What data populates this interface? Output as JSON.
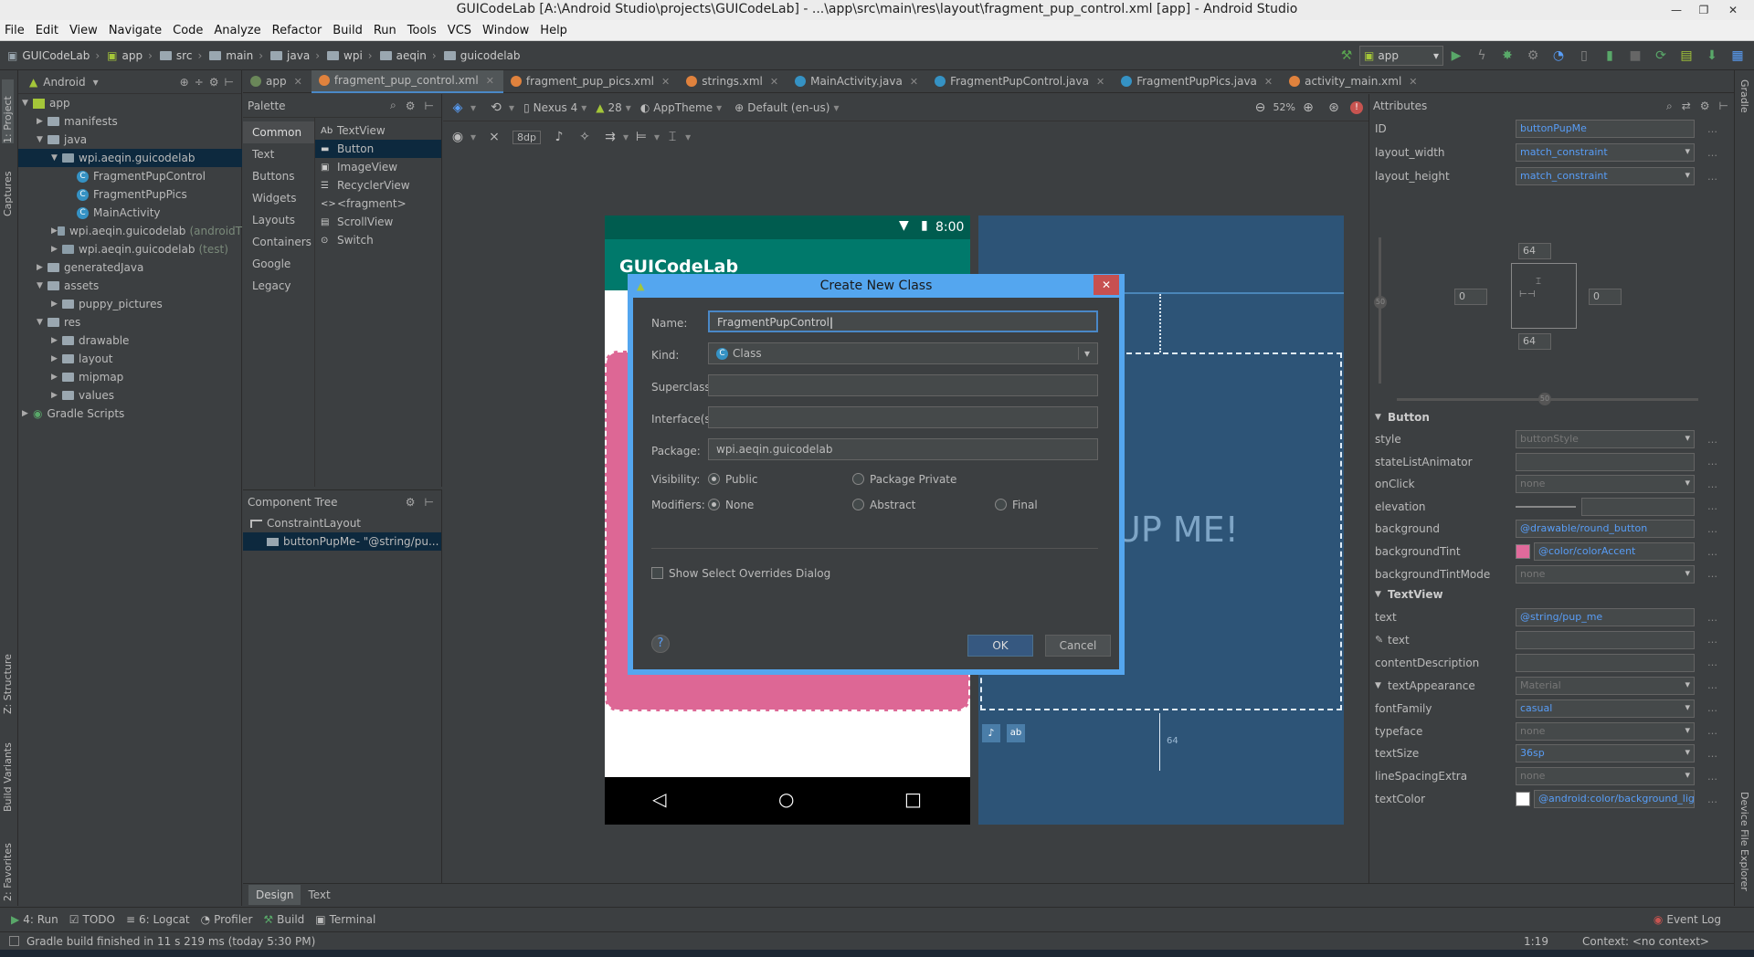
{
  "window": {
    "title": "GUICodeLab [A:\\Android Studio\\projects\\GUICodeLab] - ...\\app\\src\\main\\res\\layout\\fragment_pup_control.xml [app] - Android Studio"
  },
  "menu": [
    "File",
    "Edit",
    "View",
    "Navigate",
    "Code",
    "Analyze",
    "Refactor",
    "Build",
    "Run",
    "Tools",
    "VCS",
    "Window",
    "Help"
  ],
  "breadcrumbs": [
    "GUICodeLab",
    "app",
    "src",
    "main",
    "java",
    "wpi",
    "aeqin",
    "guicodelab"
  ],
  "run_config": "app",
  "left_stripe": [
    "1: Project",
    "Captures",
    "Z: Structure",
    "Build Variants",
    "2: Favorites"
  ],
  "right_stripe": [
    "Gradle",
    "Device File Explorer"
  ],
  "project": {
    "view": "Android",
    "tree": [
      {
        "label": "app",
        "level": 0,
        "arrow": "down",
        "icon": "module"
      },
      {
        "label": "manifests",
        "level": 1,
        "arrow": "right",
        "icon": "folder"
      },
      {
        "label": "java",
        "level": 1,
        "arrow": "down",
        "icon": "folder"
      },
      {
        "label": "wpi.aeqin.guicodelab",
        "level": 2,
        "arrow": "down",
        "icon": "package",
        "selected": true
      },
      {
        "label": "FragmentPupControl",
        "level": 3,
        "icon": "class"
      },
      {
        "label": "FragmentPupPics",
        "level": 3,
        "icon": "class"
      },
      {
        "label": "MainActivity",
        "level": 3,
        "icon": "class"
      },
      {
        "label": "wpi.aeqin.guicodelab",
        "suffix": "(androidT",
        "level": 2,
        "arrow": "right",
        "icon": "package"
      },
      {
        "label": "wpi.aeqin.guicodelab",
        "suffix": "(test)",
        "level": 2,
        "arrow": "right",
        "icon": "package"
      },
      {
        "label": "generatedJava",
        "level": 1,
        "arrow": "right",
        "icon": "folder"
      },
      {
        "label": "assets",
        "level": 1,
        "arrow": "down",
        "icon": "folder"
      },
      {
        "label": "puppy_pictures",
        "level": 2,
        "arrow": "right",
        "icon": "folder"
      },
      {
        "label": "res",
        "level": 1,
        "arrow": "down",
        "icon": "folder"
      },
      {
        "label": "drawable",
        "level": 2,
        "arrow": "right",
        "icon": "folder"
      },
      {
        "label": "layout",
        "level": 2,
        "arrow": "right",
        "icon": "folder"
      },
      {
        "label": "mipmap",
        "level": 2,
        "arrow": "right",
        "icon": "folder"
      },
      {
        "label": "values",
        "level": 2,
        "arrow": "right",
        "icon": "folder"
      },
      {
        "label": "Gradle Scripts",
        "level": 0,
        "arrow": "right",
        "icon": "gradle"
      }
    ]
  },
  "tabs": [
    {
      "label": "app",
      "color": "#6a8759"
    },
    {
      "label": "fragment_pup_control.xml",
      "color": "#e0823d",
      "active": true
    },
    {
      "label": "fragment_pup_pics.xml",
      "color": "#e0823d"
    },
    {
      "label": "strings.xml",
      "color": "#e0823d"
    },
    {
      "label": "MainActivity.java",
      "color": "#3592c4"
    },
    {
      "label": "FragmentPupControl.java",
      "color": "#3592c4"
    },
    {
      "label": "FragmentPupPics.java",
      "color": "#3592c4"
    },
    {
      "label": "activity_main.xml",
      "color": "#e0823d"
    }
  ],
  "palette": {
    "title": "Palette",
    "categories": [
      "Common",
      "Text",
      "Buttons",
      "Widgets",
      "Layouts",
      "Containers",
      "Google",
      "Legacy"
    ],
    "active_category": "Common",
    "items": [
      {
        "icon": "Ab",
        "label": "TextView"
      },
      {
        "icon": "▬",
        "label": "Button",
        "selected": true
      },
      {
        "icon": "▣",
        "label": "ImageView"
      },
      {
        "icon": "☰",
        "label": "RecyclerView"
      },
      {
        "icon": "<>",
        "label": "<fragment>"
      },
      {
        "icon": "▤",
        "label": "ScrollView"
      },
      {
        "icon": "⊙",
        "label": "Switch"
      }
    ]
  },
  "component_tree": {
    "title": "Component Tree",
    "items": [
      {
        "label": "ConstraintLayout",
        "level": 0
      },
      {
        "label": "buttonPupMe- \"@string/pu...",
        "level": 1,
        "selected": true
      }
    ]
  },
  "design_toolbar": {
    "device": "Nexus 4",
    "api": "28",
    "theme": "AppTheme",
    "locale": "Default (en-us)",
    "zoom": "52%",
    "margin": "8dp"
  },
  "preview": {
    "status_time": "8:00",
    "app_title": "GUICodeLab",
    "button_text": "UP ME!",
    "margin_label": "64"
  },
  "dialog": {
    "title": "Create New Class",
    "name_label": "Name:",
    "name_value": "FragmentPupControl",
    "kind_label": "Kind:",
    "kind_value": "Class",
    "superclass_label": "Superclass:",
    "superclass_value": "",
    "interfaces_label": "Interface(s):",
    "interfaces_value": "",
    "package_label": "Package:",
    "package_value": "wpi.aeqin.guicodelab",
    "visibility_label": "Visibility:",
    "vis_public": "Public",
    "vis_private": "Package Private",
    "modifiers_label": "Modifiers:",
    "mod_none": "None",
    "mod_abstract": "Abstract",
    "mod_final": "Final",
    "overrides_label": "Show Select Overrides Dialog",
    "ok": "OK",
    "cancel": "Cancel",
    "help": "?"
  },
  "attributes": {
    "title": "Attributes",
    "top": [
      {
        "label": "ID",
        "value": "buttonPupMe"
      },
      {
        "label": "layout_width",
        "value": "match_constraint",
        "dropdown": true
      },
      {
        "label": "layout_height",
        "value": "match_constraint",
        "dropdown": true
      }
    ],
    "constraints": {
      "top": "64",
      "bottom": "64",
      "left": "0",
      "right": "0",
      "bias_v": "50",
      "bias_h": "50"
    },
    "button_section": "Button",
    "button_rows": [
      {
        "label": "style",
        "value": "buttonStyle",
        "dropdown": true,
        "gray": true
      },
      {
        "label": "stateListAnimator",
        "value": ""
      },
      {
        "label": "onClick",
        "value": "none",
        "dropdown": true,
        "gray": true
      },
      {
        "label": "elevation",
        "value": "",
        "slider": true
      },
      {
        "label": "background",
        "value": "@drawable/round_button"
      },
      {
        "label": "backgroundTint",
        "value": "@color/colorAccent",
        "swatch": "#e06a9b"
      },
      {
        "label": "backgroundTintMode",
        "value": "none",
        "dropdown": true,
        "gray": true
      }
    ],
    "textview_section": "TextView",
    "textview_rows": [
      {
        "label": "text",
        "value": "@string/pup_me"
      },
      {
        "label": "text",
        "value": "",
        "tool": true
      },
      {
        "label": "contentDescription",
        "value": ""
      },
      {
        "label": "textAppearance",
        "value": "Material",
        "dropdown": true,
        "gray": true,
        "section": true
      },
      {
        "label": "fontFamily",
        "value": "casual",
        "dropdown": true
      },
      {
        "label": "typeface",
        "value": "none",
        "dropdown": true,
        "gray": true
      },
      {
        "label": "textSize",
        "value": "36sp",
        "dropdown": true
      },
      {
        "label": "lineSpacingExtra",
        "value": "none",
        "dropdown": true,
        "gray": true
      },
      {
        "label": "textColor",
        "value": "@android:color/background_lig",
        "swatch": "#ffffff"
      }
    ]
  },
  "bottom_tabs": [
    "Design",
    "Text"
  ],
  "tool_windows": [
    {
      "label": "4: Run",
      "icon": "run-icon"
    },
    {
      "label": "TODO",
      "icon": "todo-icon"
    },
    {
      "label": "6: Logcat",
      "icon": "logcat-icon"
    },
    {
      "label": "Profiler",
      "icon": "profiler-icon"
    },
    {
      "label": "Build",
      "icon": "build-icon"
    },
    {
      "label": "Terminal",
      "icon": "terminal-icon"
    }
  ],
  "event_log": "Event Log",
  "status": {
    "message": "Gradle build finished in 11 s 219 ms (today 5:30 PM)",
    "position": "1:19",
    "context": "Context: <no context>"
  },
  "colors": {
    "accent": "#4a88c7",
    "dialog_border": "#54a6ef",
    "phone_bar": "#00796b",
    "phone_status": "#005c4f",
    "button_pink": "#dd6795",
    "blueprint": "#2d5477"
  }
}
